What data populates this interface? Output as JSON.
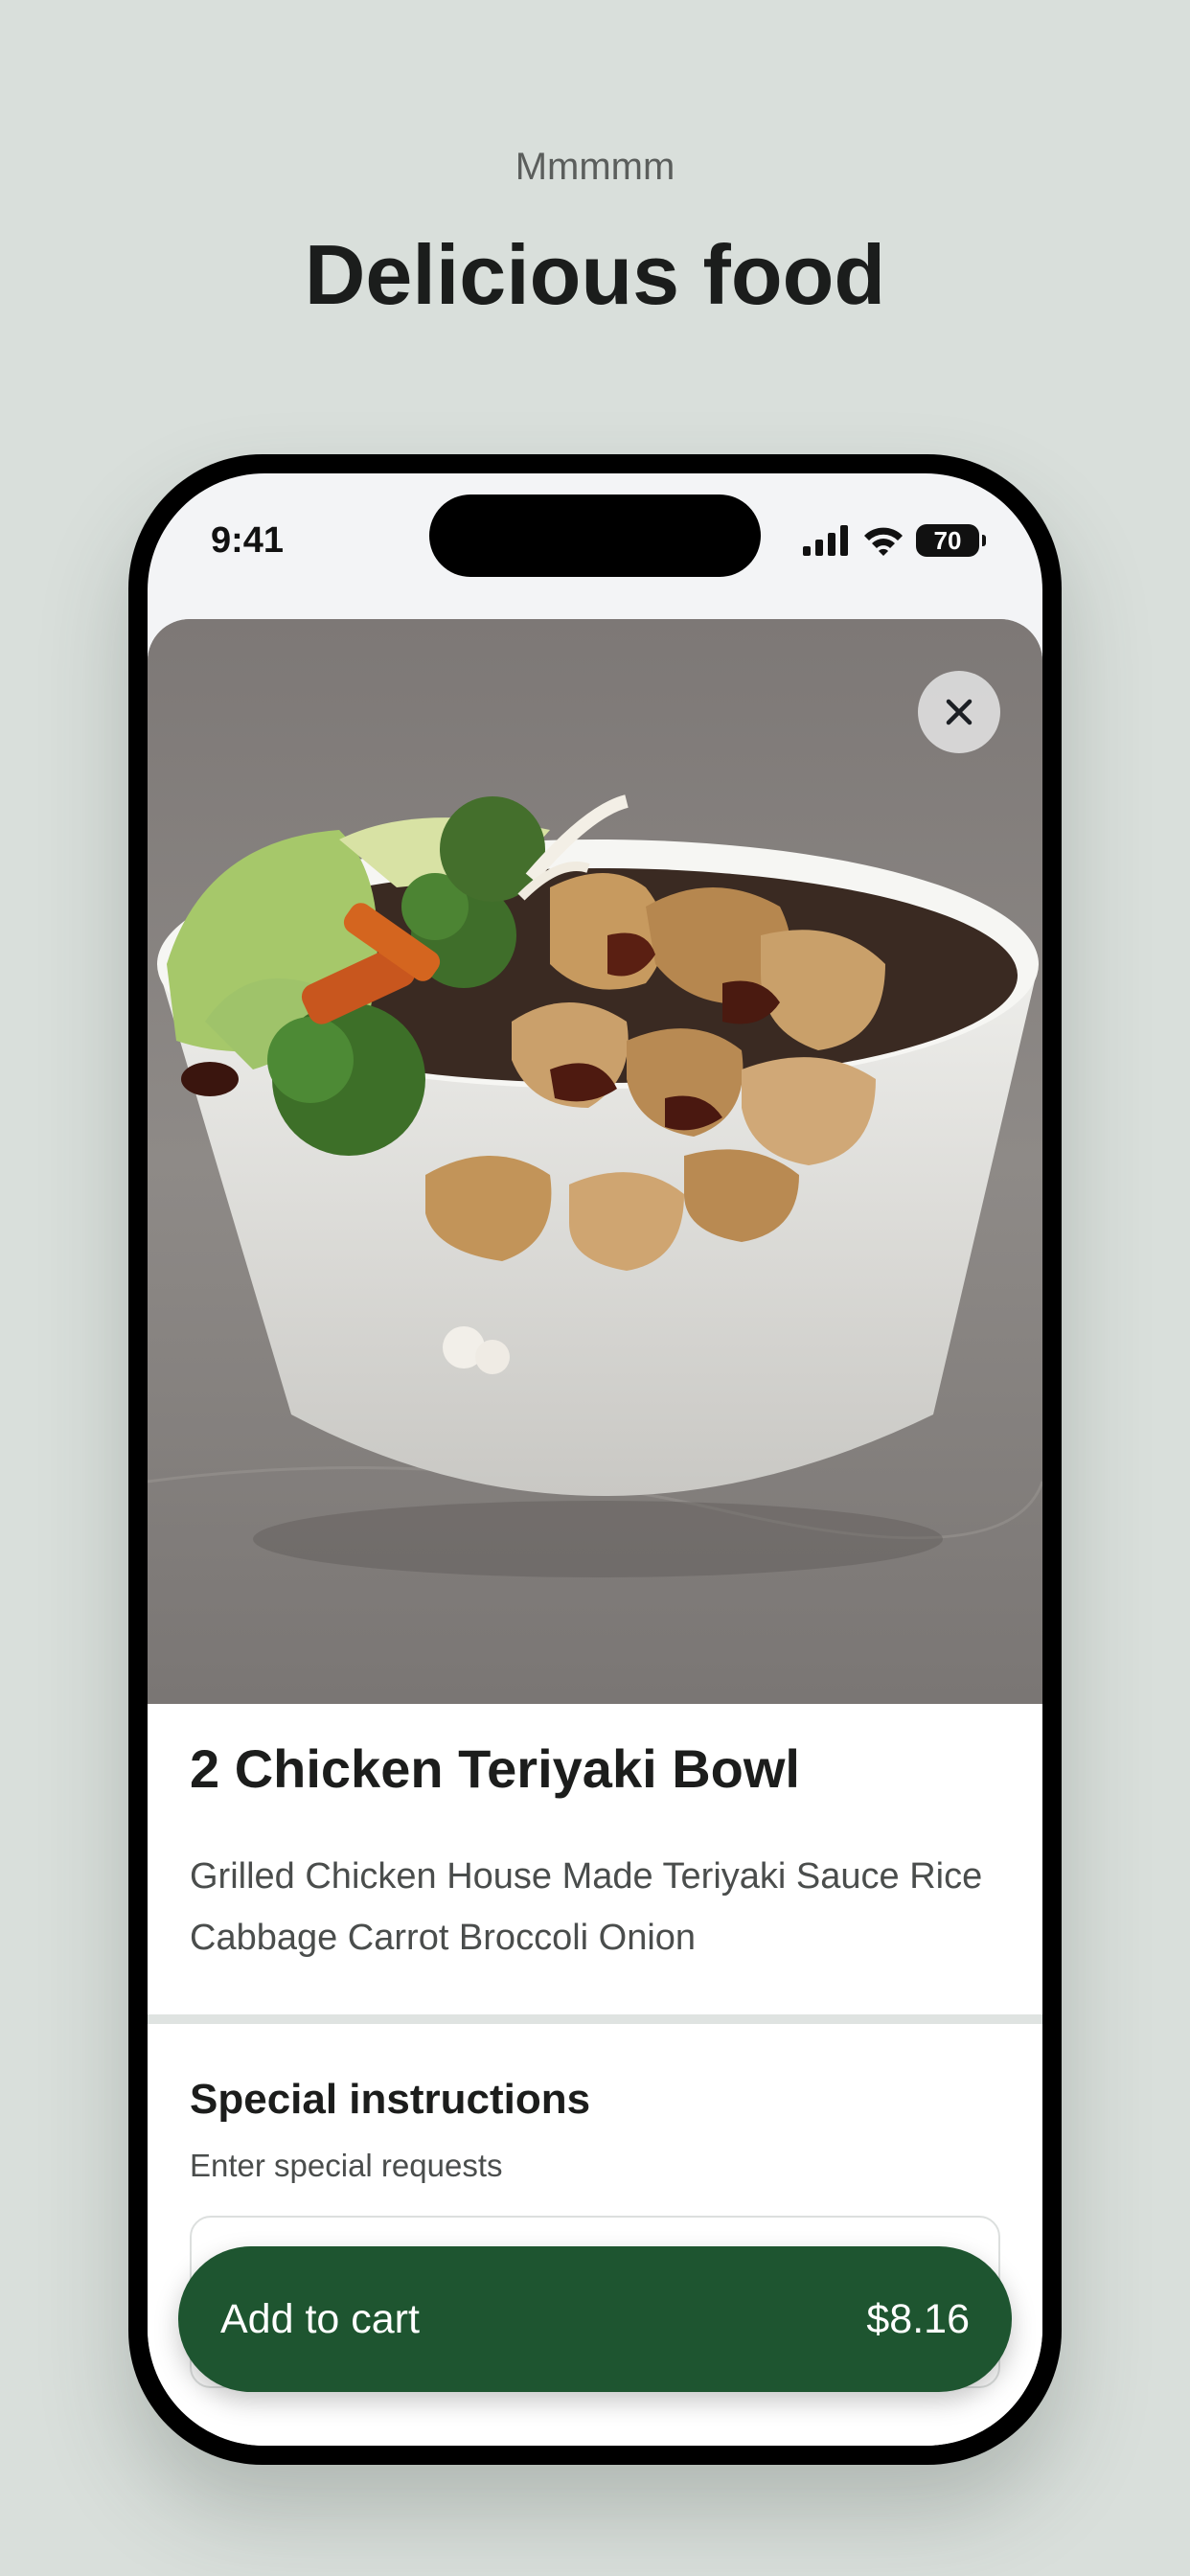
{
  "header": {
    "tagline": "Mmmmm",
    "headline": "Delicious food"
  },
  "status_bar": {
    "time": "9:41",
    "battery": "70",
    "icons": [
      "cellular-signal-icon",
      "wifi-icon",
      "battery-icon"
    ]
  },
  "product": {
    "image_icon": "close-icon",
    "name": "2 Chicken Teriyaki Bowl",
    "description": "Grilled Chicken House Made Teriyaki Sauce Rice Cabbage Carrot Broccoli Onion"
  },
  "instructions": {
    "title": "Special instructions",
    "subtitle": "Enter special requests"
  },
  "cart": {
    "label": "Add to cart",
    "price": "$8.16"
  },
  "colors": {
    "background": "#d9dfdb",
    "accent": "#1e5530",
    "text": "#1c1d1c"
  }
}
